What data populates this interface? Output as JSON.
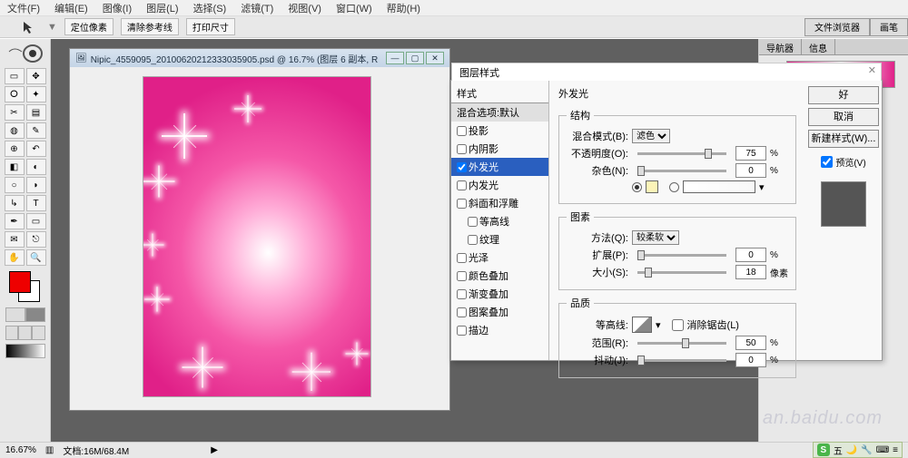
{
  "menu": {
    "file": "文件(F)",
    "edit": "编辑(E)",
    "image": "图像(I)",
    "layer": "图层(L)",
    "select": "选择(S)",
    "filter": "滤镜(T)",
    "view": "视图(V)",
    "window": "窗口(W)",
    "help": "帮助(H)"
  },
  "optbar": {
    "btn1": "定位像素",
    "btn2": "清除参考线",
    "btn3": "打印尺寸"
  },
  "top_tabs": {
    "browser": "文件浏览器",
    "brush": "画笔"
  },
  "docwin": {
    "title": "Nipic_4559095_20100620212333035905.psd @ 16.7% (图层 6 副本, R"
  },
  "rightpanel": {
    "nav": "导航器",
    "info": "信息"
  },
  "dialog": {
    "title": "图层样式",
    "styles_head": "样式",
    "blend_defaults": "混合选项:默认",
    "items": {
      "drop_shadow": "投影",
      "inner_shadow": "内阴影",
      "outer_glow": "外发光",
      "inner_glow": "内发光",
      "bevel": "斜面和浮雕",
      "contour": "等高线",
      "texture": "纹理",
      "satin": "光泽",
      "color_overlay": "颜色叠加",
      "gradient_overlay": "渐变叠加",
      "pattern_overlay": "图案叠加",
      "stroke": "描边"
    },
    "section_outer_glow": "外发光",
    "grp_structure": "结构",
    "blend_mode_label": "混合模式(B):",
    "blend_mode_val": "滤色",
    "opacity_label": "不透明度(O):",
    "opacity_val": "75",
    "opacity_unit": "%",
    "noise_label": "杂色(N):",
    "noise_val": "0",
    "noise_unit": "%",
    "grp_elements": "图素",
    "technique_label": "方法(Q):",
    "technique_val": "较柔软",
    "spread_label": "扩展(P):",
    "spread_val": "0",
    "spread_unit": "%",
    "size_label": "大小(S):",
    "size_val": "18",
    "size_unit": "像素",
    "grp_quality": "品质",
    "contour_label": "等高线:",
    "anti_label": "消除锯齿(L)",
    "range_label": "范围(R):",
    "range_val": "50",
    "range_unit": "%",
    "jitter_label": "抖动(J):",
    "jitter_val": "0",
    "jitter_unit": "%",
    "ok": "好",
    "cancel": "取消",
    "new_style": "新建样式(W)...",
    "preview": "预览(V)"
  },
  "status": {
    "zoom": "16.67%",
    "doc": "文档:16M/68.4M"
  },
  "ime": {
    "label": "五",
    "moon": "🌙",
    "wrench": "🔧",
    "kb": "⌨",
    "menu": "≡"
  },
  "watermark": "an.baidu.com"
}
